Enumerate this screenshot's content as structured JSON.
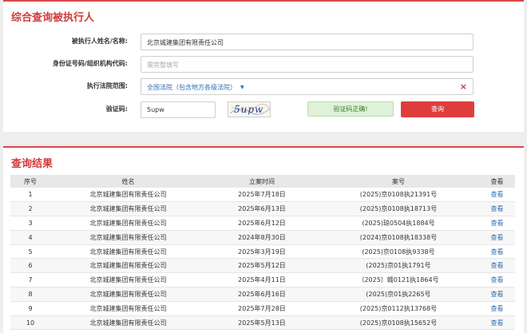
{
  "query": {
    "title": "综合查询被执行人",
    "name_label": "被执行人姓名/名称:",
    "name_value": "北京城建集团有限责任公司",
    "id_label": "身份证号码/组织机构代码:",
    "id_placeholder": "需完整填写",
    "court_label": "执行法院范围:",
    "court_value": "全国法院（包含地方各级法院）",
    "captcha_label": "验证码:",
    "captcha_value": "5upw",
    "captcha_image_text": "5upw",
    "captcha_ok": "验证码正确!",
    "submit_label": "查询"
  },
  "results": {
    "title": "查询结果",
    "columns": [
      "序号",
      "姓名",
      "立案时间",
      "案号",
      "查看"
    ],
    "rows": [
      {
        "no": "1",
        "name": "北京城建集团有限责任公司",
        "date": "2025年7月18日",
        "case": "(2025)京0108执21391号",
        "view": "查看"
      },
      {
        "no": "2",
        "name": "北京城建集团有限责任公司",
        "date": "2025年6月13日",
        "case": "(2025)京0108执18713号",
        "view": "查看"
      },
      {
        "no": "3",
        "name": "北京城建集团有限责任公司",
        "date": "2025年6月12日",
        "case": "(2025)琼0504执1884号",
        "view": "查看"
      },
      {
        "no": "4",
        "name": "北京城建集团有限责任公司",
        "date": "2024年8月30日",
        "case": "(2024)京0108执18338号",
        "view": "查看"
      },
      {
        "no": "5",
        "name": "北京城建集团有限责任公司",
        "date": "2025年3月19日",
        "case": "(2025)京0108执9338号",
        "view": "查看"
      },
      {
        "no": "6",
        "name": "北京城建集团有限责任公司",
        "date": "2025年5月12日",
        "case": "(2025)京01执1791号",
        "view": "查看"
      },
      {
        "no": "7",
        "name": "北京城建集团有限责任公司",
        "date": "2025年4月11日",
        "case": "（2025）赣0121执1864号",
        "view": "查看"
      },
      {
        "no": "8",
        "name": "北京城建集团有限责任公司",
        "date": "2025年6月16日",
        "case": "(2025)京01执2265号",
        "view": "查看"
      },
      {
        "no": "9",
        "name": "北京城建集团有限责任公司",
        "date": "2025年7月28日",
        "case": "(2025)京0112执13768号",
        "view": "查看"
      },
      {
        "no": "10",
        "name": "北京城建集团有限责任公司",
        "date": "2025年5月13日",
        "case": "(2025)京0108执15652号",
        "view": "查看"
      }
    ]
  },
  "colors": {
    "accent": "#d23a3a",
    "link": "#2f6db3",
    "success": "#dff1d8"
  }
}
